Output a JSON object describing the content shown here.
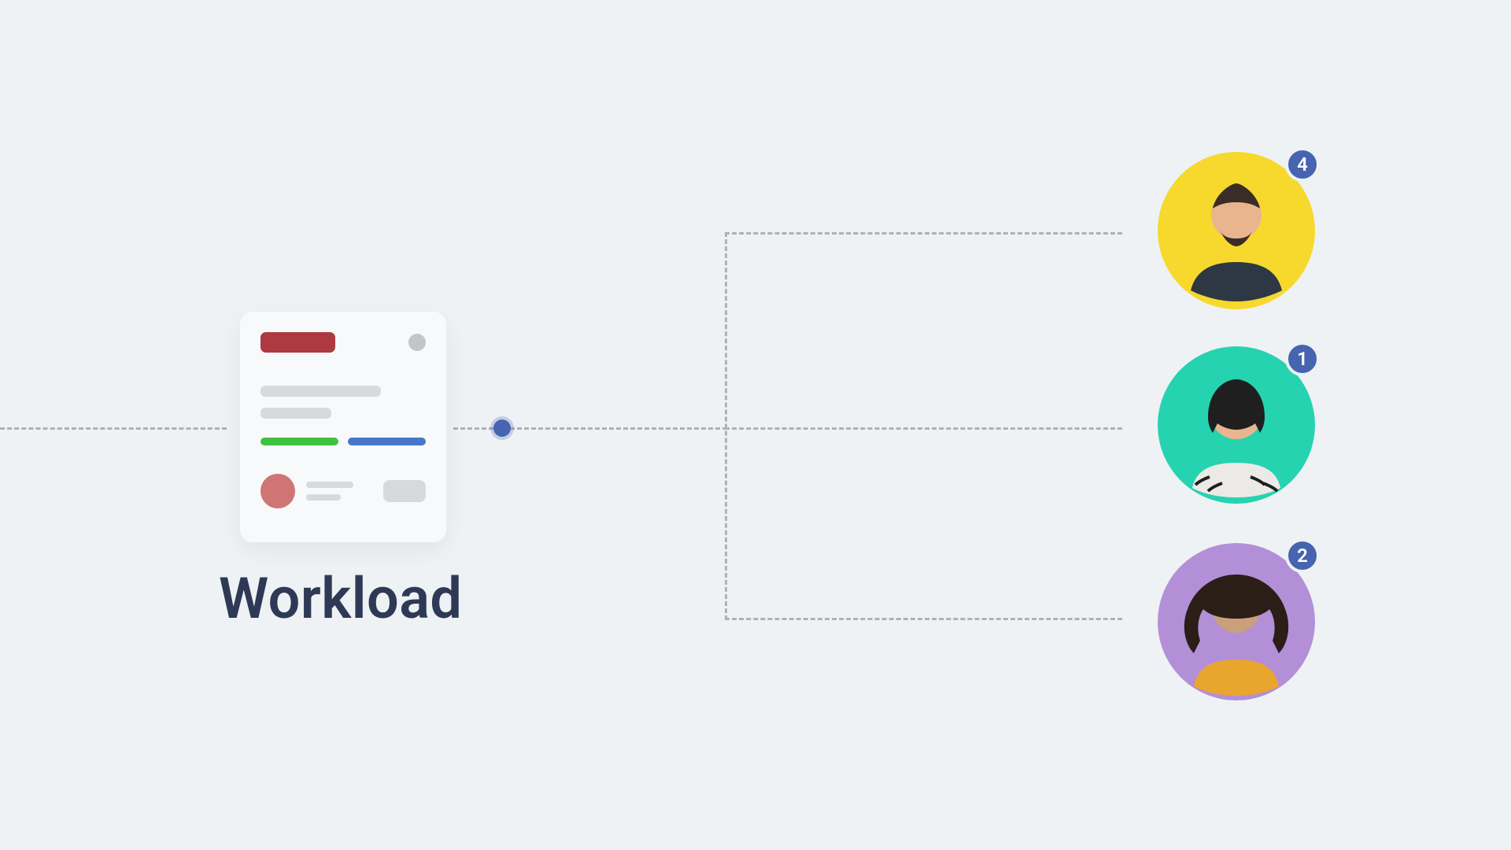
{
  "card": {
    "title": "Workload"
  },
  "people": [
    {
      "badge": "4",
      "bg": "#f6d92c"
    },
    {
      "badge": "1",
      "bg": "#25d3b0"
    },
    {
      "badge": "2",
      "bg": "#b38fd8"
    }
  ],
  "colors": {
    "accent_blue": "#4664b0",
    "red": "#ad3a41",
    "green": "#3fc23f",
    "line_blue": "#4576c9"
  }
}
